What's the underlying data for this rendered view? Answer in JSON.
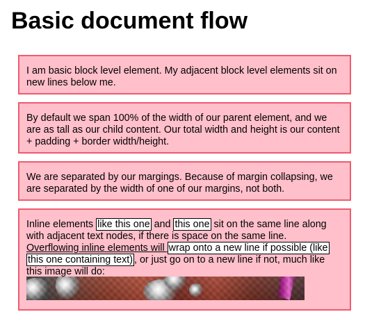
{
  "page": {
    "title": "Basic document flow"
  },
  "colors": {
    "box_background": "#ffc0cb",
    "box_border": "#f05a6e",
    "inline_outline": "#000000"
  },
  "blocks": [
    {
      "text": "I am basic block level element. My adjacent block level elements sit on new lines below me."
    },
    {
      "text": "By default we span 100% of the width of our parent element, and we are as tall as our child content. Our total width and height is our content + padding + border width/height."
    },
    {
      "text": "We are separated by our margings. Because of margin collapsing, we are separated by the width of one of our margins, not both."
    },
    {
      "parts": {
        "p1": "Inline elements ",
        "inline1": "like this one",
        "p2": " and ",
        "inline2": "this one",
        "p3": " sit on the same line along with adjacent text nodes, if there is space on the same line. ",
        "overflow": "Overflowing inline elements will ",
        "inline3": "wrap onto a new line if possible (like this one containing text)",
        "p4": ", or just go on to a new line if not, much like this image will do:"
      },
      "image": {
        "icon": "photo-image"
      }
    }
  ]
}
